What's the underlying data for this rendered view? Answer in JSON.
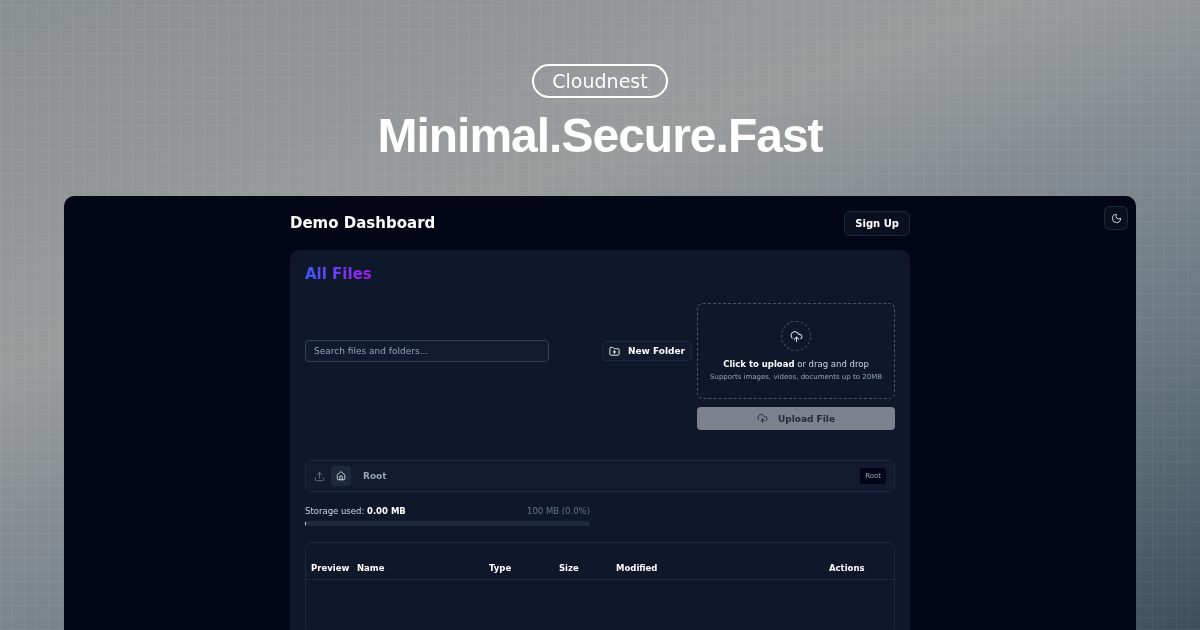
{
  "hero": {
    "badge": "Cloudnest",
    "headline": "Minimal.Secure.Fast"
  },
  "header": {
    "title": "Demo Dashboard",
    "sign_up": "Sign Up"
  },
  "card": {
    "title": "All Files",
    "search": {
      "placeholder": "Search files and folders..."
    },
    "new_folder": "New Folder",
    "dropzone": {
      "lead": "**Click to upload** or drag and drop",
      "hint": "Supports images, videos, documents up to 20MB"
    },
    "upload_button": {
      "label": "Upload File",
      "disabled": true
    },
    "breadcrumb": {
      "current": "Root",
      "tag": "Root"
    },
    "storage": {
      "label": "Storage used: **0.00 MB**",
      "total": "100 MB (0.0%)",
      "level": 0.005
    },
    "table": {
      "columns": [
        "Preview",
        "Name",
        "Type",
        "Size",
        "Modified",
        "Actions"
      ]
    }
  }
}
